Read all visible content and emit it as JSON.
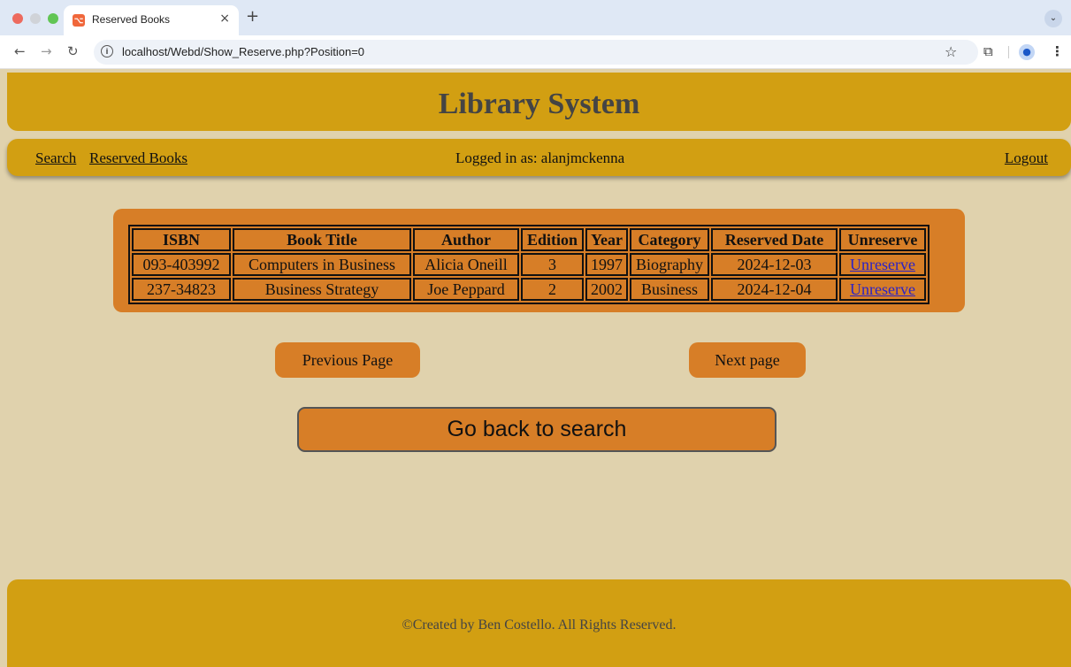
{
  "browser": {
    "tab_title": "Reserved Books",
    "favicon_glyph": "⌥",
    "url": "localhost/Webd/Show_Reserve.php?Position=0"
  },
  "header": {
    "title": "Library System"
  },
  "nav": {
    "search": "Search",
    "reserved": "Reserved Books",
    "logged_in": "Logged in as: alanjmckenna",
    "logout": "Logout"
  },
  "table": {
    "headers": [
      "ISBN",
      "Book Title",
      "Author",
      "Edition",
      "Year",
      "Category",
      "Reserved Date",
      "Unreserve"
    ],
    "rows": [
      [
        "093-403992",
        "Computers in Business",
        "Alicia Oneill",
        "3",
        "1997",
        "Biography",
        "2024-12-03",
        "Unreserve"
      ],
      [
        "237-34823",
        "Business Strategy",
        "Joe Peppard",
        "2",
        "2002",
        "Business",
        "2024-12-04",
        "Unreserve"
      ]
    ]
  },
  "pagination": {
    "prev": "Previous Page",
    "next": "Next page"
  },
  "back_button": "Go back to search",
  "footer": "©Created by Ben Costello. All Rights Reserved.",
  "colors": {
    "gold": "#d29f12",
    "orange": "#d77e27",
    "page_bg": "#e0d2ad",
    "link": "#2a22c7"
  }
}
